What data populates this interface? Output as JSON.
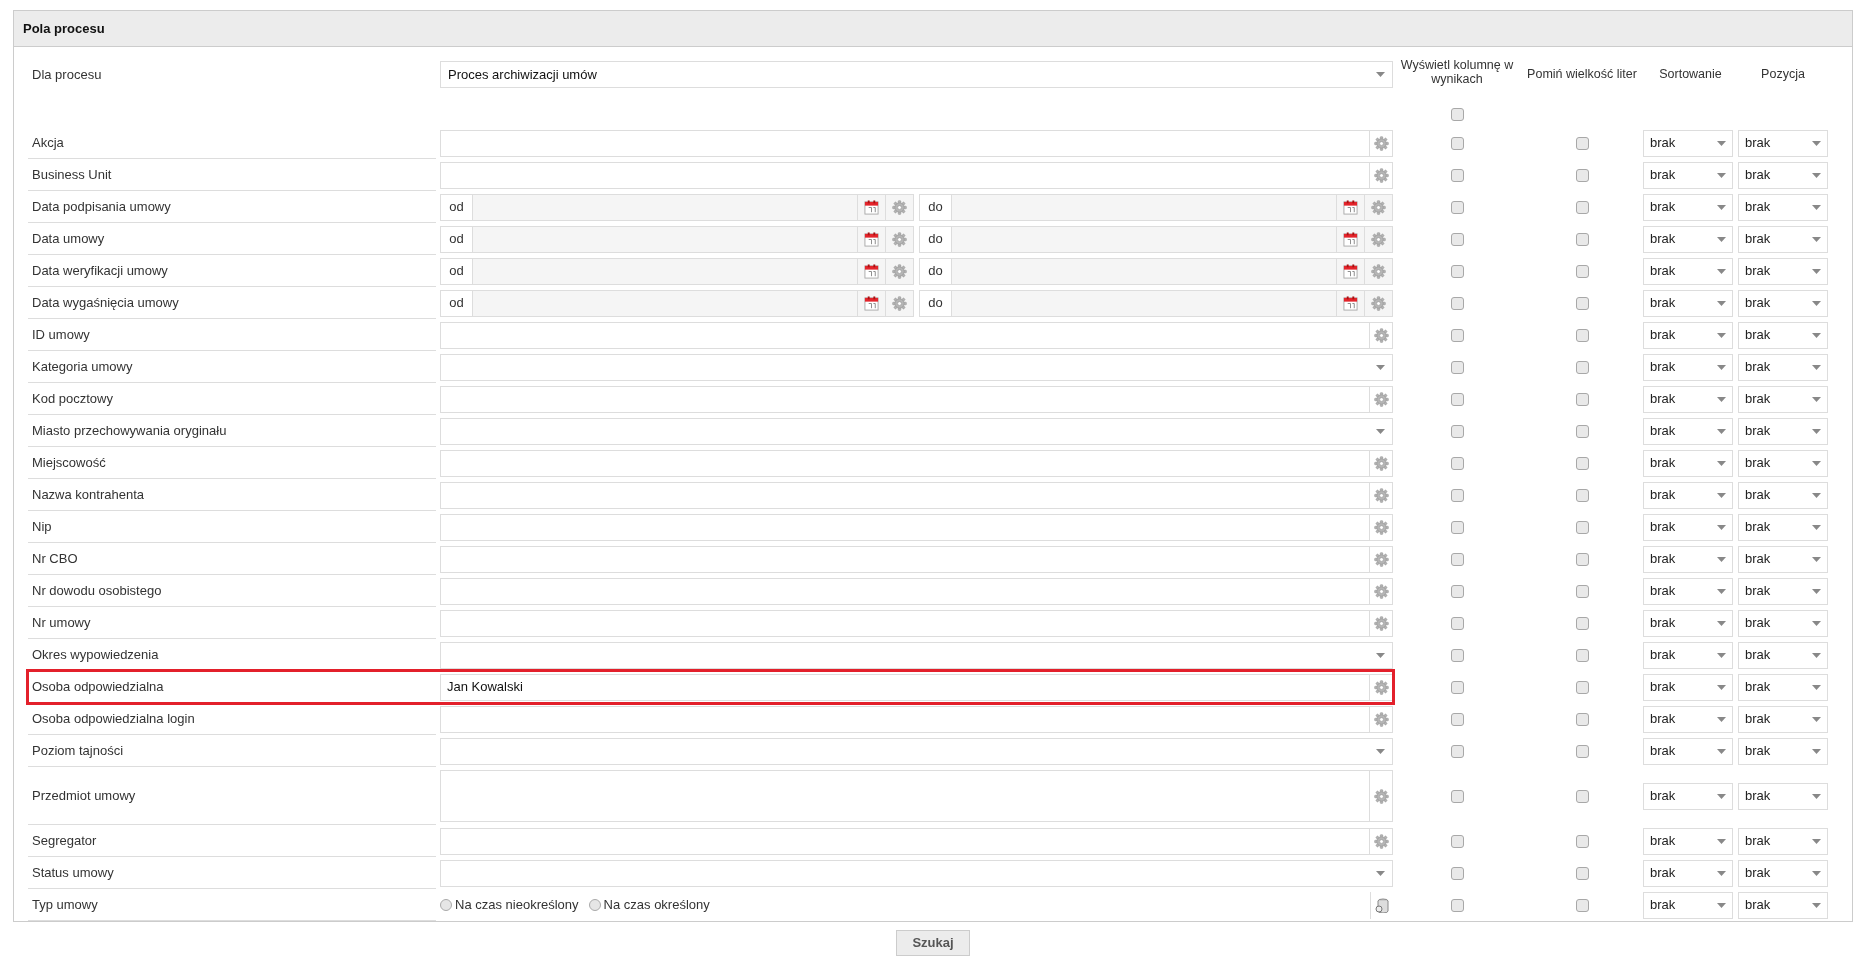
{
  "panel": {
    "title": "Pola procesu"
  },
  "process": {
    "label": "Dla procesu",
    "value": "Proces archiwizacji umów"
  },
  "columns": {
    "show": "Wyświetl kolumnę w wynikach",
    "ignore_case": "Pomiń wielkość liter",
    "sort": "Sortowanie",
    "position": "Pozycja"
  },
  "show_all": {
    "checked": false
  },
  "fields": [
    {
      "label": "Akcja",
      "kind": "text",
      "show": false,
      "ignore_case": false,
      "sort": "brak",
      "position": "brak"
    },
    {
      "label": "Business Unit",
      "kind": "text",
      "show": false,
      "ignore_case": false,
      "sort": "brak",
      "position": "brak"
    },
    {
      "label": "Data podpisania umowy",
      "kind": "date",
      "from": "od",
      "to": "do",
      "show": false,
      "ignore_case": false,
      "sort": "brak",
      "position": "brak"
    },
    {
      "label": "Data umowy",
      "kind": "date",
      "from": "od",
      "to": "do",
      "show": false,
      "ignore_case": false,
      "sort": "brak",
      "position": "brak"
    },
    {
      "label": "Data weryfikacji umowy",
      "kind": "date",
      "from": "od",
      "to": "do",
      "show": false,
      "ignore_case": false,
      "sort": "brak",
      "position": "brak"
    },
    {
      "label": "Data wygaśnięcia umowy",
      "kind": "date",
      "from": "od",
      "to": "do",
      "show": false,
      "ignore_case": false,
      "sort": "brak",
      "position": "brak"
    },
    {
      "label": "ID umowy",
      "kind": "text",
      "show": false,
      "ignore_case": false,
      "sort": "brak",
      "position": "brak"
    },
    {
      "label": "Kategoria umowy",
      "kind": "select",
      "show": false,
      "ignore_case": false,
      "sort": "brak",
      "position": "brak"
    },
    {
      "label": "Kod pocztowy",
      "kind": "text",
      "show": false,
      "ignore_case": false,
      "sort": "brak",
      "position": "brak"
    },
    {
      "label": "Miasto przechowywania oryginału",
      "kind": "select",
      "show": false,
      "ignore_case": false,
      "sort": "brak",
      "position": "brak"
    },
    {
      "label": "Miejscowość",
      "kind": "text",
      "show": false,
      "ignore_case": false,
      "sort": "brak",
      "position": "brak"
    },
    {
      "label": "Nazwa kontrahenta",
      "kind": "text",
      "show": false,
      "ignore_case": false,
      "sort": "brak",
      "position": "brak"
    },
    {
      "label": "Nip",
      "kind": "text",
      "show": false,
      "ignore_case": false,
      "sort": "brak",
      "position": "brak"
    },
    {
      "label": "Nr CBO",
      "kind": "text",
      "show": false,
      "ignore_case": false,
      "sort": "brak",
      "position": "brak"
    },
    {
      "label": "Nr dowodu osobistego",
      "kind": "text",
      "show": false,
      "ignore_case": false,
      "sort": "brak",
      "position": "brak"
    },
    {
      "label": "Nr umowy",
      "kind": "text",
      "show": false,
      "ignore_case": false,
      "sort": "brak",
      "position": "brak"
    },
    {
      "label": "Okres wypowiedzenia",
      "kind": "select",
      "show": false,
      "ignore_case": false,
      "sort": "brak",
      "position": "brak"
    },
    {
      "label": "Osoba odpowiedzialna",
      "kind": "text",
      "value": "Jan Kowalski",
      "highlighted": true,
      "show": false,
      "ignore_case": false,
      "sort": "brak",
      "position": "brak"
    },
    {
      "label": "Osoba odpowiedzialna login",
      "kind": "text",
      "show": false,
      "ignore_case": false,
      "sort": "brak",
      "position": "brak"
    },
    {
      "label": "Poziom tajności",
      "kind": "select",
      "show": false,
      "ignore_case": false,
      "sort": "brak",
      "position": "brak"
    },
    {
      "label": "Przedmiot umowy",
      "kind": "textarea",
      "show": false,
      "ignore_case": false,
      "sort": "brak",
      "position": "brak"
    },
    {
      "label": "Segregator",
      "kind": "text",
      "show": false,
      "ignore_case": false,
      "sort": "brak",
      "position": "brak"
    },
    {
      "label": "Status umowy",
      "kind": "select",
      "show": false,
      "ignore_case": false,
      "sort": "brak",
      "position": "brak"
    },
    {
      "label": "Typ umowy",
      "kind": "radio",
      "options": [
        {
          "label": "Na czas nieokreślony",
          "selected": false
        },
        {
          "label": "Na czas określony",
          "selected": false
        }
      ],
      "show": false,
      "ignore_case": false,
      "sort": "brak",
      "position": "brak"
    }
  ],
  "search_button": "Szukaj"
}
